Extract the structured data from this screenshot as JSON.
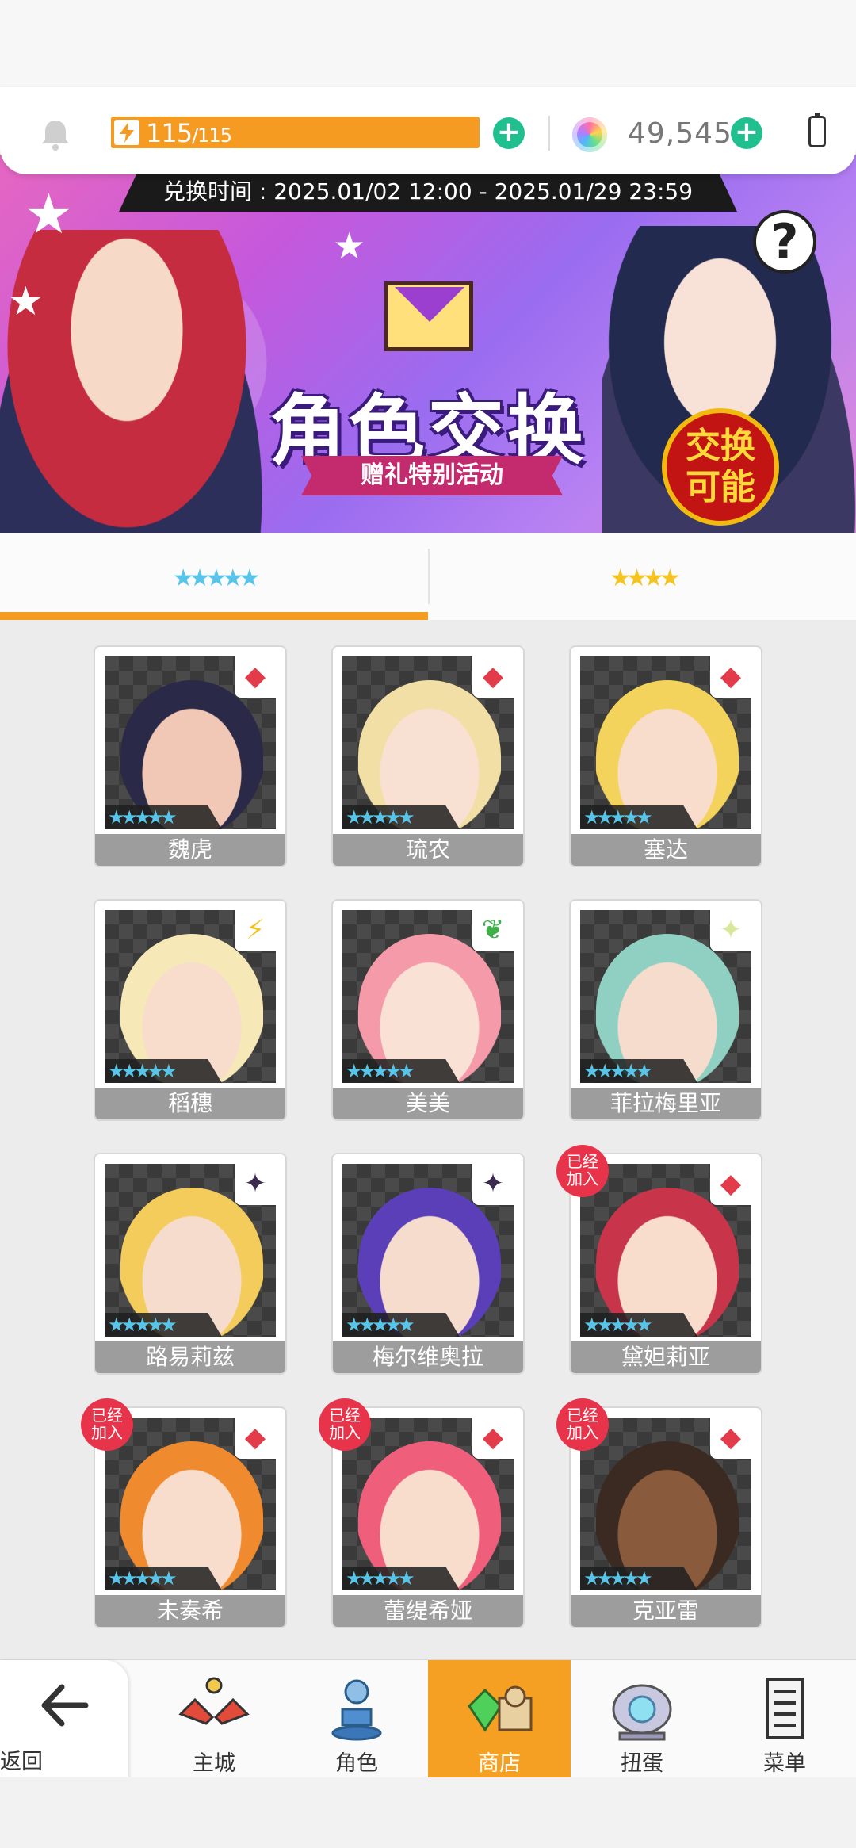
{
  "topbar": {
    "stamina_current": "115",
    "stamina_max": "/115",
    "stamina_fraction": 1.0,
    "gems": "49,545"
  },
  "banner": {
    "exchange_time": "兑换时间 : 2025.01/02 12:00 - 2025.01/29 23:59",
    "title": "角色交换",
    "subtitle": "赠礼特别活动",
    "badge_line1": "交换",
    "badge_line2": "可能",
    "help_symbol": "?"
  },
  "tabs": [
    {
      "label": "★★★★★",
      "active": true
    },
    {
      "label": "★★★★",
      "active": false
    }
  ],
  "rarity_stars": "★★★★★",
  "characters": [
    {
      "name": "魏虎",
      "element": "fire-element-icon",
      "element_glyph": "◆",
      "element_color": "#e23b4a",
      "hair": "#2a2a48",
      "skin": "#f1c8b6",
      "joined": false
    },
    {
      "name": "琉农",
      "element": "fire-element-icon",
      "element_glyph": "◆",
      "element_color": "#e23b4a",
      "hair": "#f1dfa6",
      "skin": "#f8e0d2",
      "joined": false
    },
    {
      "name": "塞达",
      "element": "fire-element-icon",
      "element_glyph": "◆",
      "element_color": "#e23b4a",
      "hair": "#f3d35b",
      "skin": "#f8dccc",
      "joined": false
    },
    {
      "name": "稻穗",
      "element": "thunder-element-icon",
      "element_glyph": "⚡",
      "element_color": "#f2c21a",
      "hair": "#f7e8b8",
      "skin": "#f8dccc",
      "joined": false
    },
    {
      "name": "美美",
      "element": "wind-element-icon",
      "element_glyph": "❦",
      "element_color": "#3db04a",
      "hair": "#f49aa8",
      "skin": "#f9e1d6",
      "joined": false
    },
    {
      "name": "菲拉梅里亚",
      "element": "light-element-icon",
      "element_glyph": "✦",
      "element_color": "#d8e89a",
      "hair": "#8fd0c2",
      "skin": "#f6dccd",
      "joined": false
    },
    {
      "name": "路易莉兹",
      "element": "dark-element-icon",
      "element_glyph": "✦",
      "element_color": "#3a2b4f",
      "hair": "#f3cc5c",
      "skin": "#f6dccd",
      "joined": false
    },
    {
      "name": "梅尔维奥拉",
      "element": "dark-element-icon",
      "element_glyph": "✦",
      "element_color": "#3a2b4f",
      "hair": "#5a3fb8",
      "skin": "#f6dccd",
      "joined": false
    },
    {
      "name": "黛妲莉亚",
      "element": "fire-element-icon",
      "element_glyph": "◆",
      "element_color": "#e23b4a",
      "hair": "#c8354b",
      "skin": "#f8dccc",
      "joined": true
    },
    {
      "name": "未奏希",
      "element": "fire-element-icon",
      "element_glyph": "◆",
      "element_color": "#e23b4a",
      "hair": "#f08a2e",
      "skin": "#f8dccc",
      "joined": true
    },
    {
      "name": "蕾缇希娅",
      "element": "fire-element-icon",
      "element_glyph": "◆",
      "element_color": "#e23b4a",
      "hair": "#ef5f7c",
      "skin": "#f8dccc",
      "joined": true
    },
    {
      "name": "克亚雷",
      "element": "fire-element-icon",
      "element_glyph": "◆",
      "element_color": "#e23b4a",
      "hair": "#3a2a22",
      "skin": "#8a5a3c",
      "joined": true
    }
  ],
  "joined_label_line1": "已经",
  "joined_label_line2": "加入",
  "nav": {
    "back": "返回",
    "items": [
      {
        "label": "主城",
        "icon": "castle-icon",
        "active": false
      },
      {
        "label": "角色",
        "icon": "character-icon",
        "active": false
      },
      {
        "label": "商店",
        "icon": "shop-icon",
        "active": true
      },
      {
        "label": "扭蛋",
        "icon": "gacha-icon",
        "active": false
      },
      {
        "label": "菜单",
        "icon": "menu-icon",
        "active": false
      }
    ]
  },
  "colors": {
    "accent_orange": "#f59b22",
    "plus_green": "#1fbf8f",
    "joined_red": "#e8344a"
  }
}
